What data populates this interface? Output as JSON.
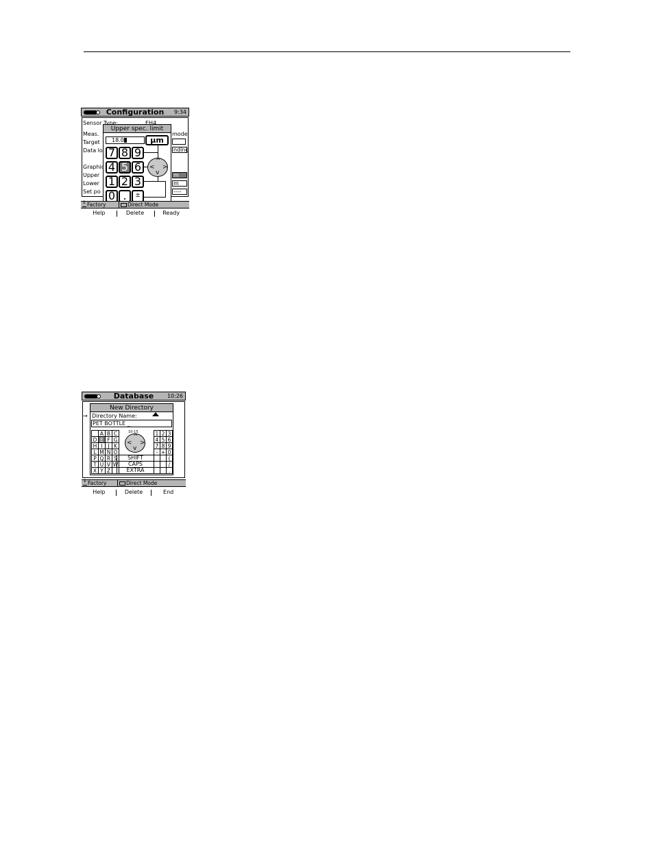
{
  "config_screen": {
    "title": "Configuration",
    "time": "9:34",
    "labels": [
      "Sensor Type:",
      "Meas.",
      "Target",
      "Data lo",
      "Graphic",
      "Upper",
      "Lower",
      "Set po"
    ],
    "sensor_value": "EH4",
    "right_fragments": [
      "mode",
      "nding",
      "m",
      "m",
      "----"
    ],
    "popup": {
      "title": "Upper spec. limit",
      "value": "18.0",
      "unit": "µm",
      "keys": [
        "7",
        "8",
        "9",
        "4",
        "5",
        "6",
        "1",
        "2",
        "3",
        "0",
        ".",
        "±"
      ],
      "selected_key": "5"
    },
    "status": {
      "left": "Factory",
      "right": "Direct Mode"
    },
    "softkeys": [
      "Help",
      "Delete",
      "Ready"
    ]
  },
  "db_screen": {
    "title": "Database",
    "time": "10:26",
    "popup": {
      "title": "New Directory",
      "field_label": "Directory Name:",
      "field_value": "PET BOTTLE _",
      "dpad_caption": "10-15",
      "letters": [
        [
          "",
          "A",
          "B",
          "C"
        ],
        [
          "D",
          "E",
          "F",
          "G"
        ],
        [
          "H",
          "I",
          "J",
          "K"
        ],
        [
          "L",
          "M",
          "N",
          "O"
        ],
        [
          "P",
          "Q",
          "R",
          "S"
        ],
        [
          "T",
          "U",
          "V",
          "W"
        ],
        [
          "X",
          "Y",
          "Z",
          ""
        ]
      ],
      "selected_letter": "E",
      "digits": [
        [
          "1",
          "2",
          "3"
        ],
        [
          "4",
          "5",
          "6"
        ],
        [
          "7",
          "8",
          "9"
        ],
        [
          "-",
          "+",
          "0"
        ],
        [
          "",
          "",
          "("
        ],
        [
          "",
          "",
          "/"
        ],
        [
          "",
          "",
          "."
        ]
      ],
      "shift": "SHIFT",
      "caps": "CAPS",
      "extra": "EXTRA"
    },
    "status": {
      "left": "Factory",
      "right": "Direct Mode"
    },
    "softkeys": [
      "Help",
      "Delete",
      "End"
    ]
  }
}
